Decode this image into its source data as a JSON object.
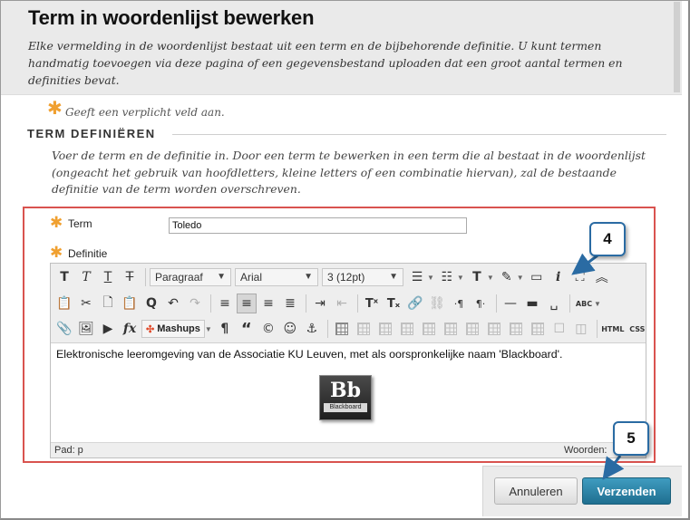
{
  "header": {
    "title": "Term in woordenlijst bewerken",
    "description": "Elke vermelding in de woordenlijst bestaat uit een term en de bijbehorende definitie. U kunt termen handmatig toevoegen via deze pagina of een gegevensbestand uploaden dat een groot aantal termen en definities bevat."
  },
  "required_note": "Geeft een verplicht veld aan.",
  "section": {
    "heading": "TERM DEFINIËREN",
    "description": "Voer de term en de definitie in. Door een term te bewerken in een term die al bestaat in de woordenlijst (ongeacht het gebruik van hoofdletters, kleine letters of een combinatie hiervan), zal de bestaande definitie van de term worden overschreven."
  },
  "form": {
    "term_label": "Term",
    "term_value": "Toledo",
    "definition_label": "Definitie"
  },
  "toolbar": {
    "paragraph_select": "Paragraaf",
    "font_select": "Arial",
    "size_select": "3 (12pt)",
    "mashups_label": "Mashups",
    "html_label": "HTML",
    "css_label": "CSS",
    "bold_glyph": "T",
    "italic_glyph": "T",
    "underline_glyph": "T",
    "strike_glyph": "T",
    "pilcrow_glyph": "¶",
    "quote_glyph": "“",
    "copyright_glyph": "©",
    "smiley_glyph": "☺",
    "anchor_glyph": "⚓",
    "fx_glyph": "fx",
    "info_glyph": "i",
    "superscript_glyph": "Tˣ",
    "subscript_glyph": "Tₓ",
    "find_glyph": "Q",
    "spell_glyph": "ABC",
    "ltr_glyph": "·¶",
    "rtl_glyph": "¶·"
  },
  "editor": {
    "content": "Elektronische leeromgeving van de Associatie KU Leuven, met als oorspronkelijke naam 'Blackboard'.",
    "logo_mark": "Bb",
    "logo_text": "Blackboard",
    "path_label": "Pad: p",
    "words_label": "Woorden:"
  },
  "callouts": {
    "c4": "4",
    "c5": "5"
  },
  "buttons": {
    "cancel": "Annuleren",
    "submit": "Verzenden"
  },
  "colors": {
    "required_asterisk": "#f0a030",
    "highlight_border": "#d9534f",
    "submit_button": "#2a82a8",
    "callout_border": "#2a6ba3"
  }
}
